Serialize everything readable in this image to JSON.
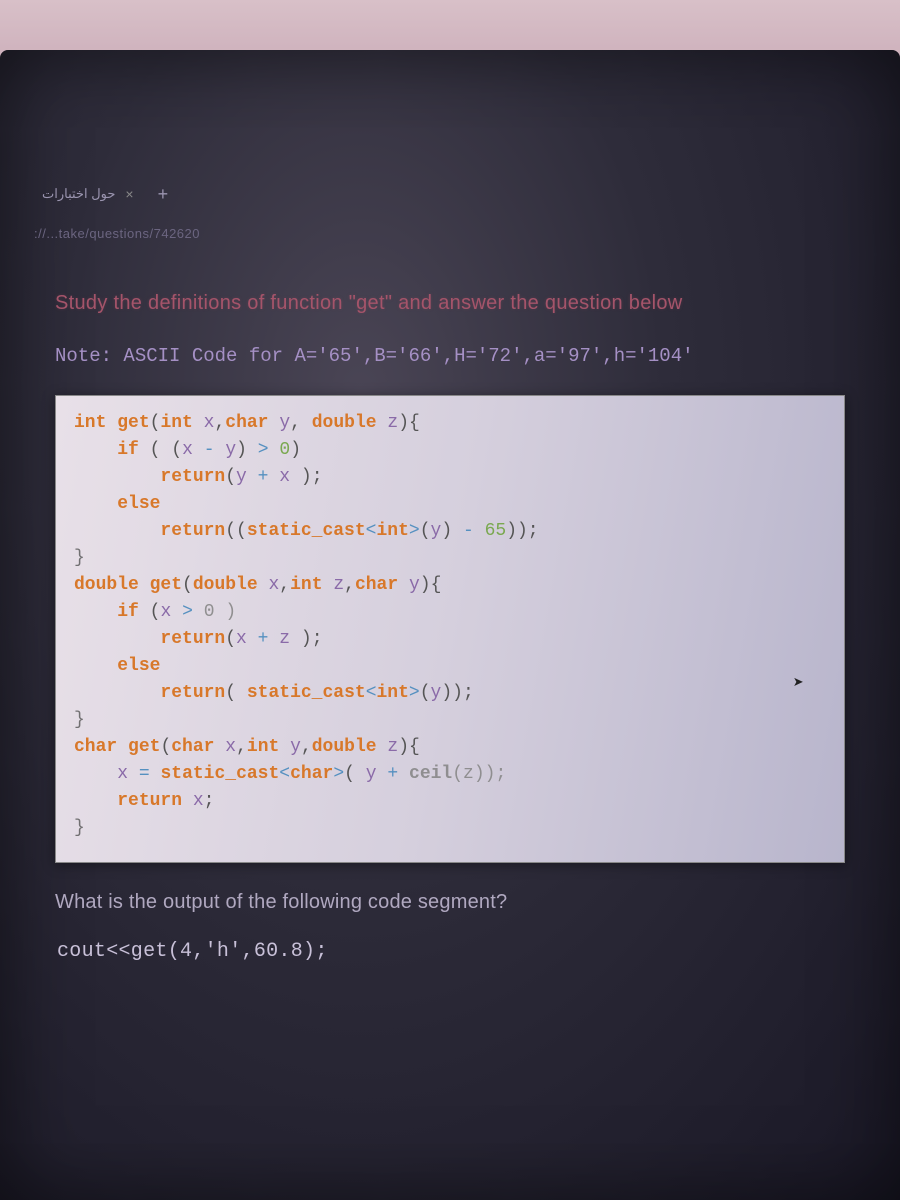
{
  "tab": {
    "title": "حول اختبارات",
    "close": "×",
    "plus": "+"
  },
  "address": "://...take/questions/742620",
  "intro": {
    "pre": "Study the definitions of function ",
    "q": "\"get\"",
    "post": " and answer the question below"
  },
  "note": {
    "label": "Note:",
    "text": " ASCII Code for  A='65',B='66',H='72',a='97',h='104'"
  },
  "code": {
    "l1": "int get(int x,char y, double z){",
    "l2": "    if ( (x - y) > 0)",
    "l3": "        return(y + x );",
    "l4": "    else",
    "l5": "        return((static_cast<int>(y) - 65));",
    "l6": "}",
    "l7": "double get(double x,int z,char y){",
    "l8": "    if (x > 0 )",
    "l9": "        return(x + z );",
    "l10": "    else",
    "l11": "        return( static_cast<int>(y));",
    "l12": "}",
    "l13": "char get(char x,int y,double z){",
    "l14": "    x = static_cast<char>( y + ceil(z));",
    "l15": "    return x;",
    "l16": "}"
  },
  "question": "What is the output of the following code segment?",
  "answer": "cout<<get(4,'h',60.8);"
}
